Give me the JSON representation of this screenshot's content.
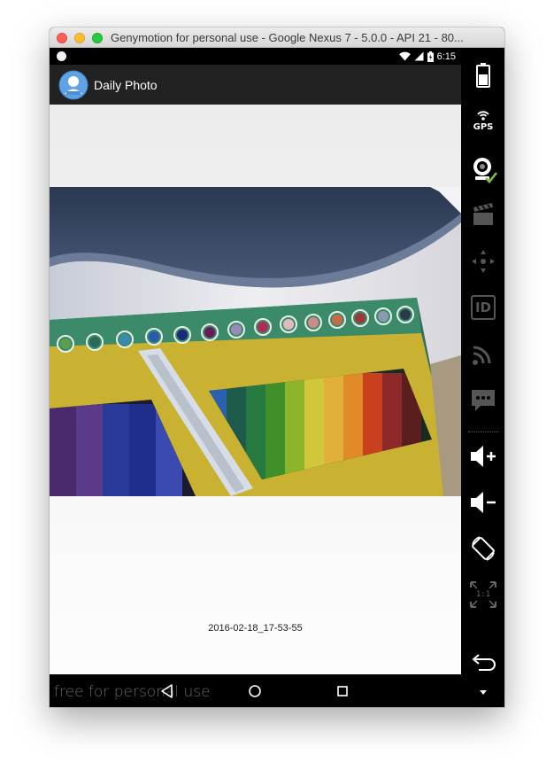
{
  "window": {
    "title": "Genymotion for personal use - Google Nexus 7 - 5.0.0 - API 21 - 80..."
  },
  "statusbar": {
    "time": "6:15"
  },
  "app": {
    "title": "Daily Photo"
  },
  "photo": {
    "caption": "2016-02-18_17-53-55"
  },
  "navbar": {
    "watermark": "free for personal use"
  },
  "sidepanel": {
    "gps_label": "GPS",
    "id_label": "ID",
    "ratio_label": "1:1"
  },
  "colors": {
    "accent_check": "#7cc142",
    "app_icon": "#5fa2e6"
  }
}
